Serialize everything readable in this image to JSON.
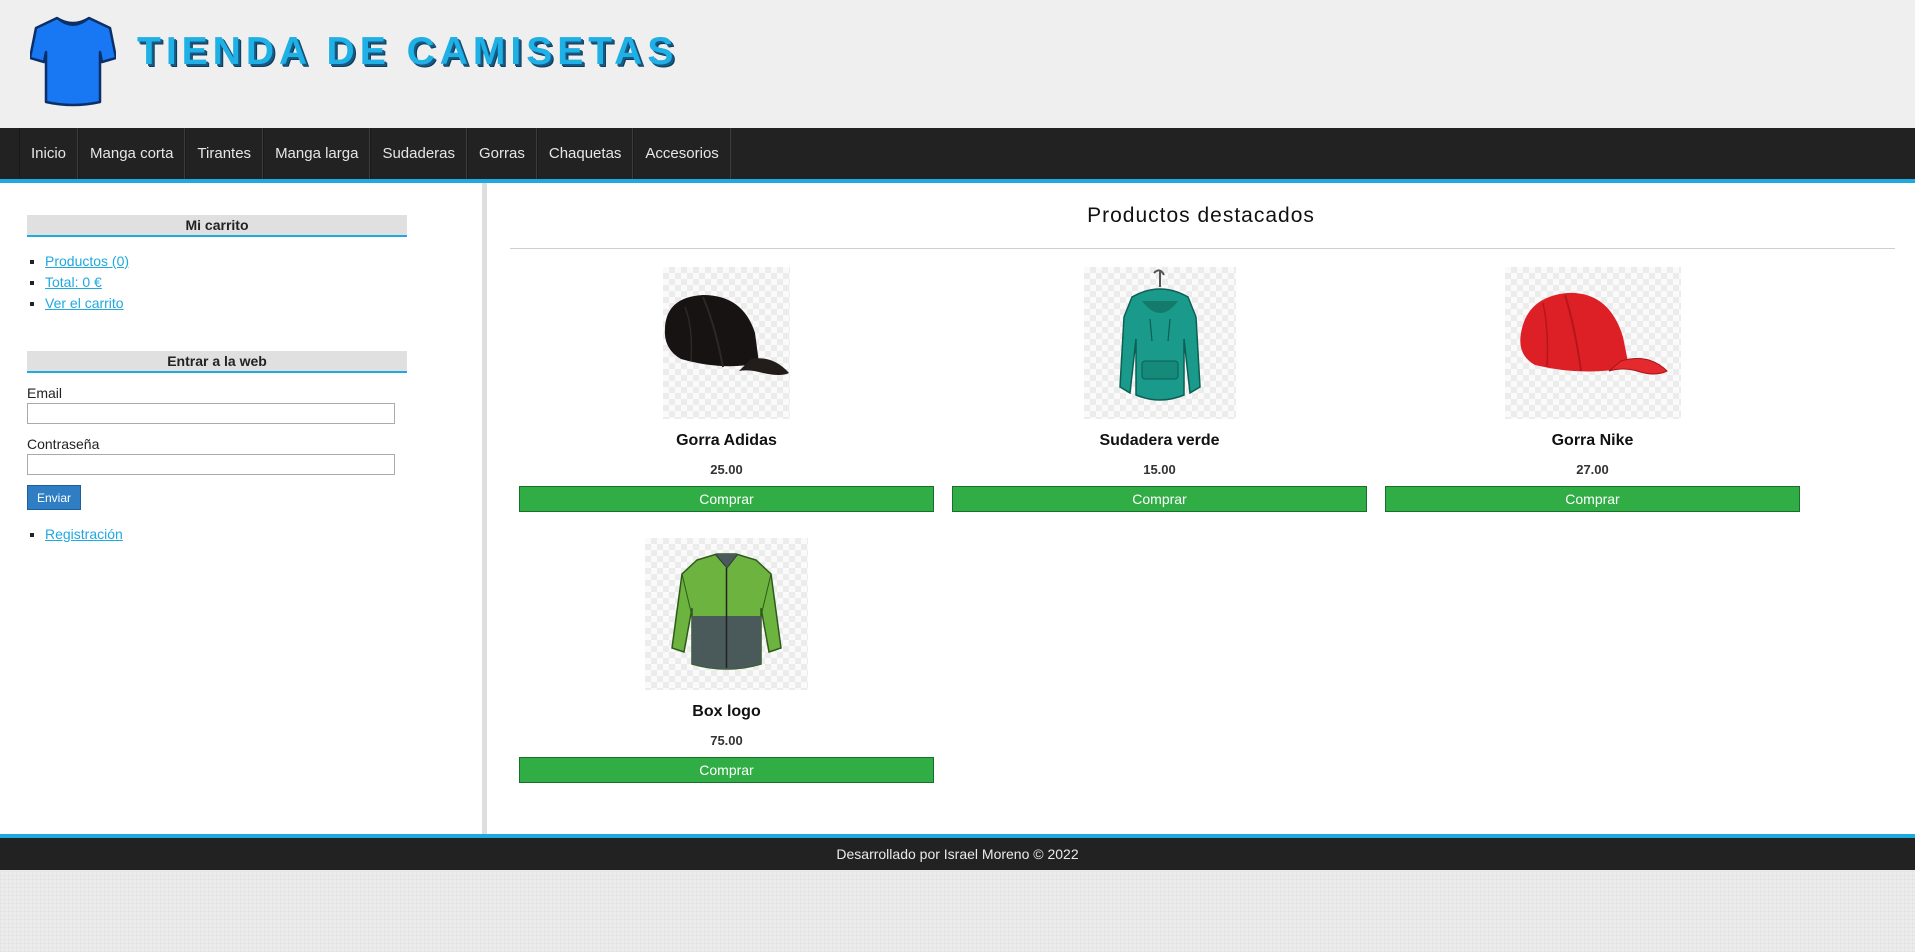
{
  "header": {
    "title": "TIENDA DE CAMISETAS",
    "logo": "tshirt-icon"
  },
  "nav": {
    "items": [
      "Inicio",
      "Manga corta",
      "Tirantes",
      "Manga larga",
      "Sudaderas",
      "Gorras",
      "Chaquetas",
      "Accesorios"
    ]
  },
  "sidebar": {
    "cart": {
      "title": "Mi carrito",
      "links": [
        "Productos (0)",
        "Total: 0 €",
        "Ver el carrito"
      ]
    },
    "login": {
      "title": "Entrar a la web",
      "email_label": "Email",
      "email_value": "",
      "password_label": "Contraseña",
      "password_value": "",
      "submit_label": "Enviar",
      "register_link": "Registración"
    }
  },
  "main": {
    "title": "Productos destacados",
    "products": [
      {
        "name": "Gorra Adidas",
        "price": "25.00",
        "buy_label": "Comprar",
        "image": "black-cap"
      },
      {
        "name": "Sudadera verde",
        "price": "15.00",
        "buy_label": "Comprar",
        "image": "green-hoodie"
      },
      {
        "name": "Gorra Nike",
        "price": "27.00",
        "buy_label": "Comprar",
        "image": "red-cap"
      },
      {
        "name": "Box logo",
        "price": "75.00",
        "buy_label": "Comprar",
        "image": "green-jacket"
      }
    ]
  },
  "footer": {
    "text": "Desarrollado por Israel Moreno © 2022"
  },
  "colors": {
    "accent": "#1ea9df",
    "nav_bg": "#222222",
    "buy_button": "#30ae45",
    "login_button": "#2f7ec4",
    "title": "#1fb0e6"
  }
}
